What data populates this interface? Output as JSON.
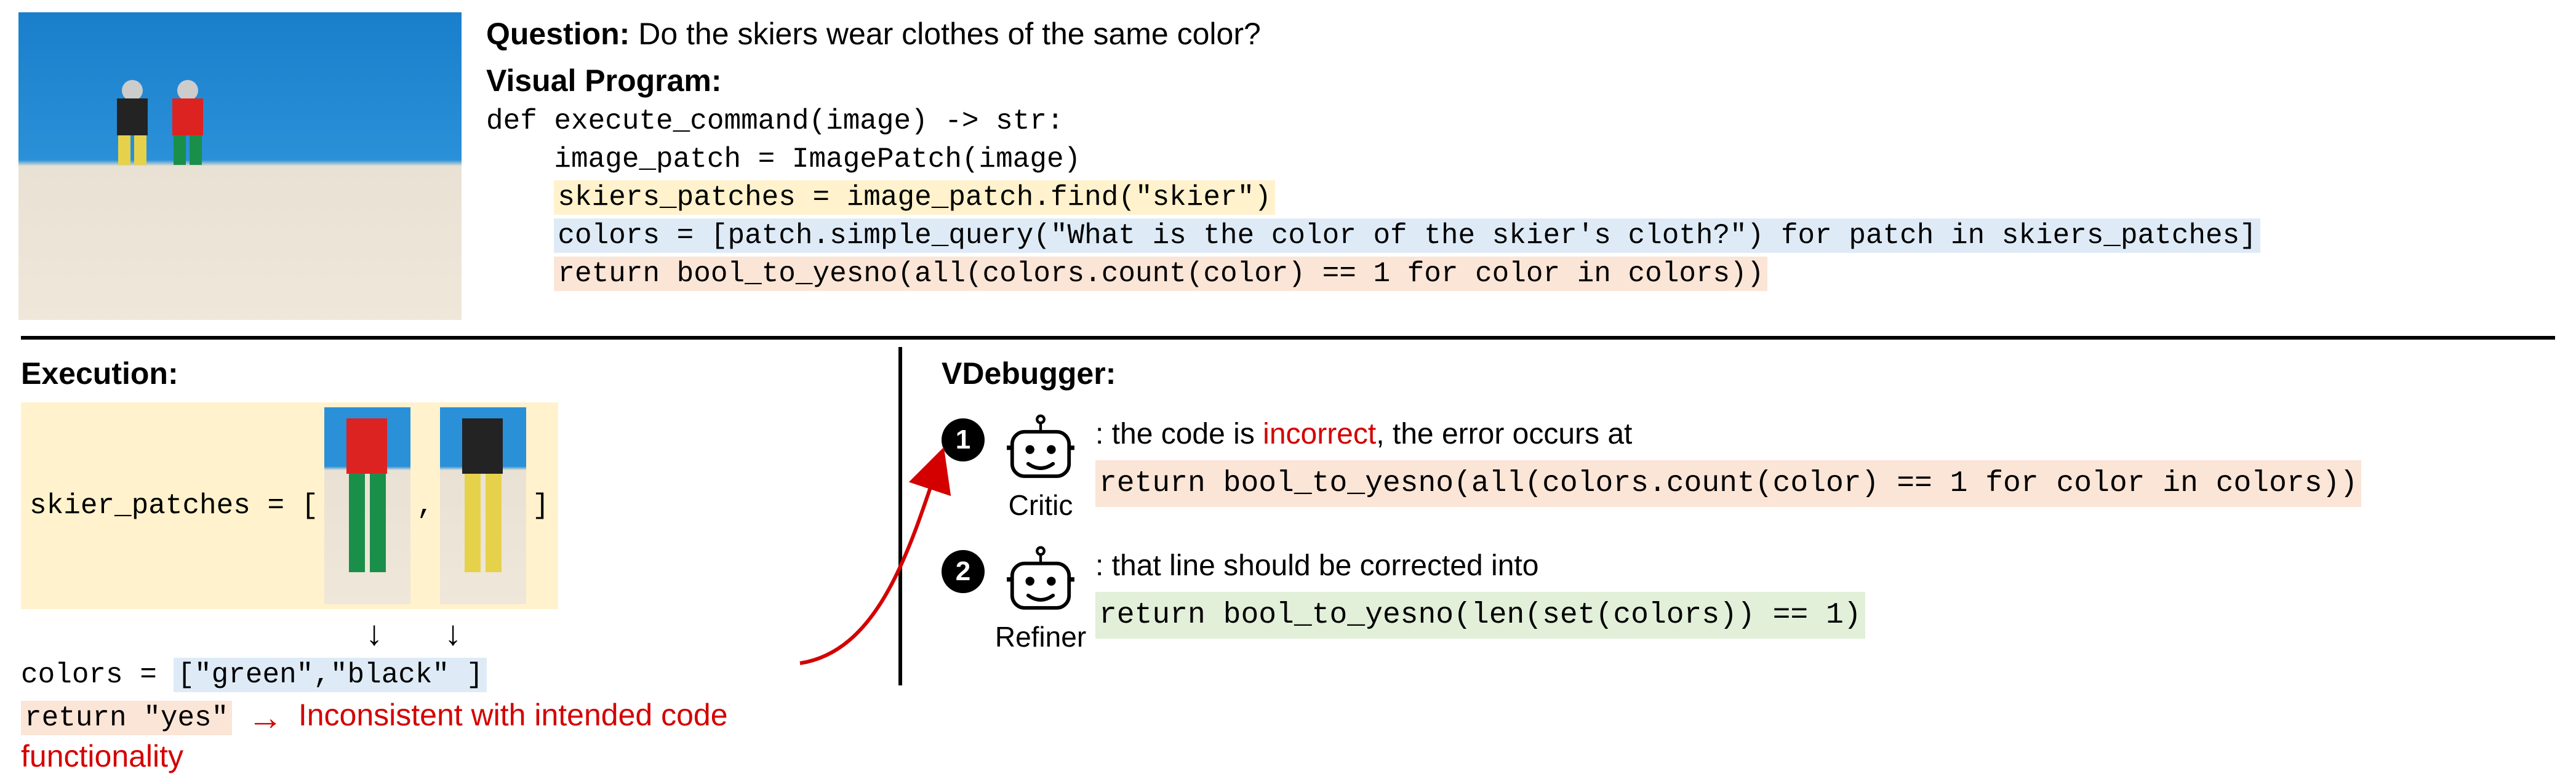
{
  "question_label": "Question:",
  "question_text": "Do the skiers wear clothes of the same color?",
  "visual_program_label": "Visual Program:",
  "code": {
    "def_line": "def execute_command(image) -> str:",
    "l1_indent": "    ",
    "l1": "image_patch = ImagePatch(image)",
    "l2_indent": "    ",
    "l2": "skiers_patches = image_patch.find(\"skier\")",
    "l3_indent": "    ",
    "l3": "colors = [patch.simple_query(\"What is the color of the skier's cloth?\") for patch in skiers_patches]",
    "l4_indent": "    ",
    "l4": "return bool_to_yesno(all(colors.count(color) == 1 for color in colors))"
  },
  "execution": {
    "title": "Execution:",
    "patches_prefix": "skier_patches = [",
    "patches_mid": ",",
    "patches_suffix": "]",
    "colors_prefix": "colors         = ",
    "colors_value": "[\"green\",\"black\" ]",
    "return_code": "return \"yes\"",
    "arrow": "→",
    "inconsistent_text": "Inconsistent with intended code functionality"
  },
  "vdebugger": {
    "title": "VDebugger:",
    "step1_num": "1",
    "critic_label": "Critic",
    "critic_text_prefix": ": the code is ",
    "critic_incorrect": "incorrect",
    "critic_text_suffix": ", the error occurs at",
    "critic_code": "return bool_to_yesno(all(colors.count(color) == 1 for color in colors))",
    "step2_num": "2",
    "refiner_label": "Refiner",
    "refiner_text": ": that line should be corrected into",
    "refiner_code": "return bool_to_yesno(len(set(colors)) == 1)"
  },
  "colors": {
    "hl_yellow": "#fff2cc",
    "hl_blue": "#deebf7",
    "hl_orange": "#fbe5d6",
    "hl_green": "#e2efd9",
    "error_red": "#d40000"
  }
}
